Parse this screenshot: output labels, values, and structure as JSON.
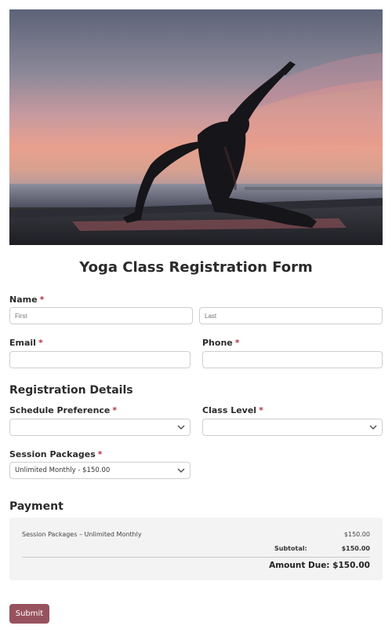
{
  "form": {
    "title": "Yoga Class Registration Form",
    "name_label": "Name",
    "name_first_placeholder": "First",
    "name_last_placeholder": "Last",
    "email_label": "Email",
    "phone_label": "Phone",
    "required_mark": "*",
    "registration_title": "Registration Details",
    "schedule_label": "Schedule Preference",
    "schedule_value": "",
    "level_label": "Class Level",
    "level_value": "",
    "packages_label": "Session Packages",
    "packages_value": "Unlimited Monthly - $150.00",
    "payment_title": "Payment",
    "submit_label": "Submit"
  },
  "payment": {
    "item_label": "Session Packages – Unlimited Monthly",
    "item_price": "$150.00",
    "subtotal_label": "Subtotal:",
    "subtotal_value": "$150.00",
    "amount_due": "Amount Due: $150.00"
  },
  "colors": {
    "accent": "#98525e",
    "required": "#b5344a",
    "payment_bg": "#f3f3f3"
  },
  "icons": {
    "select_arrow": "chevron-down-icon"
  }
}
